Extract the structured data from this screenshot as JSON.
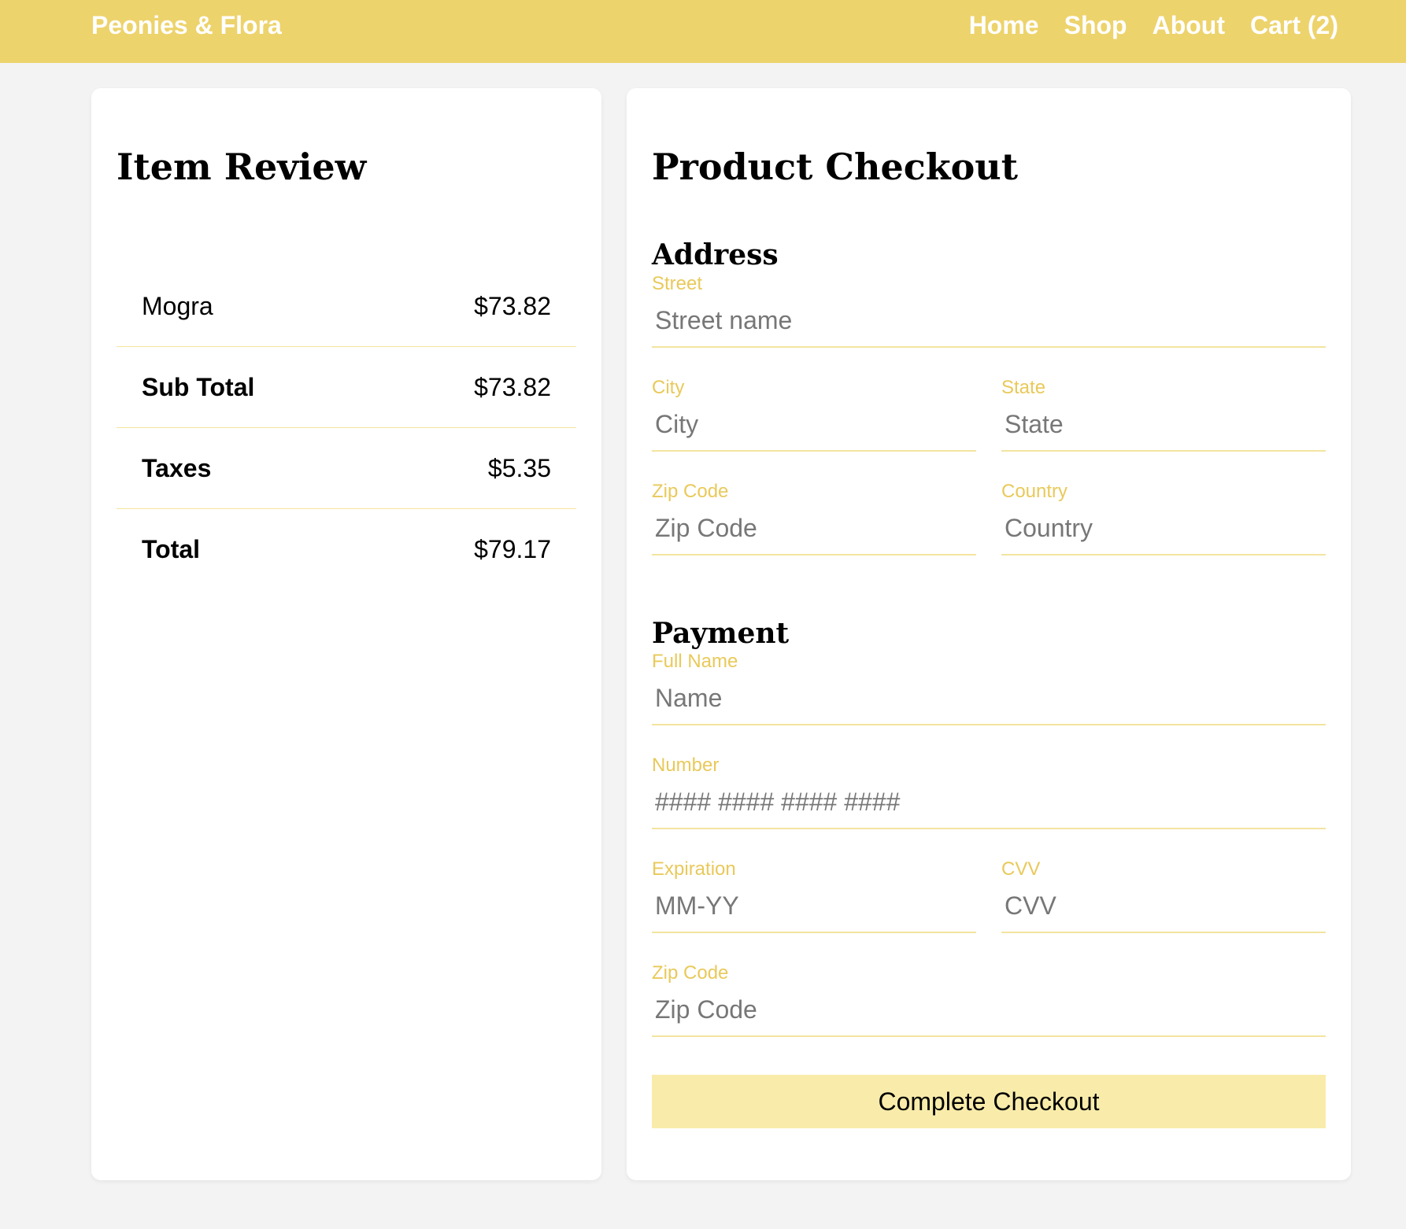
{
  "nav": {
    "brand": "Peonies & Flora",
    "links": [
      {
        "label": "Home"
      },
      {
        "label": "Shop"
      },
      {
        "label": "About"
      },
      {
        "label": "Cart (2)"
      }
    ]
  },
  "review": {
    "title": "Item Review",
    "rows": [
      {
        "label": "Mogra",
        "value": "$73.82",
        "bold": false
      },
      {
        "label": "Sub Total",
        "value": "$73.82",
        "bold": true
      },
      {
        "label": "Taxes",
        "value": "$5.35",
        "bold": true
      },
      {
        "label": "Total",
        "value": "$79.17",
        "bold": true
      }
    ]
  },
  "checkout": {
    "title": "Product Checkout",
    "address": {
      "heading": "Address",
      "street": {
        "label": "Street",
        "placeholder": "Street name",
        "value": ""
      },
      "city": {
        "label": "City",
        "placeholder": "City",
        "value": ""
      },
      "state": {
        "label": "State",
        "placeholder": "State",
        "value": ""
      },
      "zip": {
        "label": "Zip Code",
        "placeholder": "Zip Code",
        "value": ""
      },
      "country": {
        "label": "Country",
        "placeholder": "Country",
        "value": ""
      }
    },
    "payment": {
      "heading": "Payment",
      "name": {
        "label": "Full Name",
        "placeholder": "Name",
        "value": ""
      },
      "number": {
        "label": "Number",
        "placeholder": "#### #### #### ####",
        "value": ""
      },
      "expiration": {
        "label": "Expiration",
        "placeholder": "MM-YY",
        "value": ""
      },
      "cvv": {
        "label": "CVV",
        "placeholder": "CVV",
        "value": ""
      },
      "zip": {
        "label": "Zip Code",
        "placeholder": "Zip Code",
        "value": ""
      }
    },
    "submit_label": "Complete Checkout"
  },
  "colors": {
    "navbar": "#edd36c",
    "label": "#e9c95a",
    "divider": "#f3e4a0",
    "button": "#f9ecaa",
    "page_bg": "#f3f3f3"
  }
}
